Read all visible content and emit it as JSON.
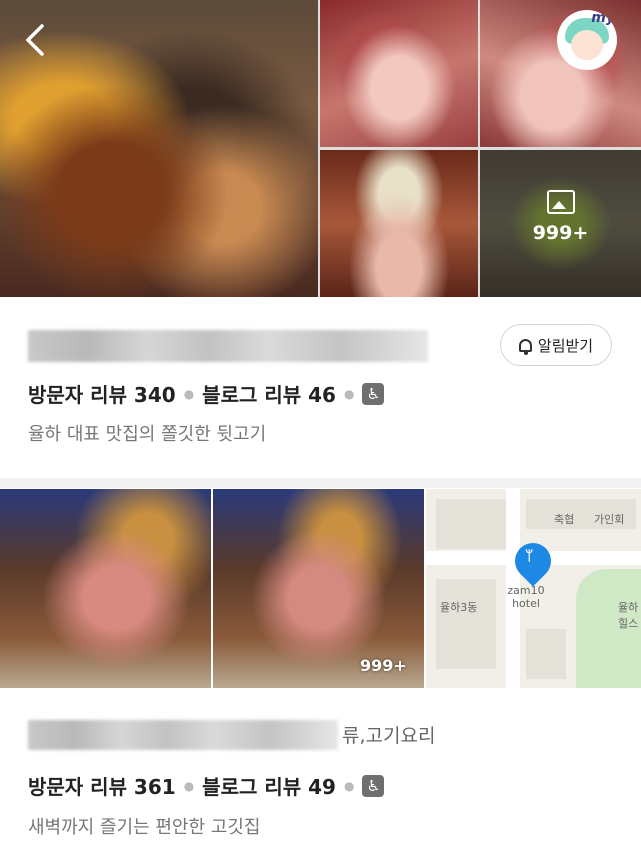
{
  "header": {
    "back_icon": "chevron-left-icon",
    "avatar_label": "my",
    "photo_count": "999+"
  },
  "card1": {
    "name": "",
    "alarm_label": "알림받기",
    "visitor_reviews": "방문자 리뷰 340",
    "blog_reviews": "블로그 리뷰 46",
    "accessibility_icon": "♿",
    "description": "율하 대표 맛집의 쫄깃한 뒷고기"
  },
  "card2": {
    "name_suffix": "류,고기요리",
    "photo_count": "999+",
    "visitor_reviews": "방문자 리뷰 361",
    "blog_reviews": "블로그 리뷰 49",
    "accessibility_icon": "♿",
    "description": "새벽까지 즐기는 편안한 고깃집",
    "map": {
      "label_top": "축협",
      "label_topright": "가인회",
      "label_left": "율하3동",
      "label_hotel": "zam10 hotel",
      "label_right": "율하 힐스"
    }
  }
}
